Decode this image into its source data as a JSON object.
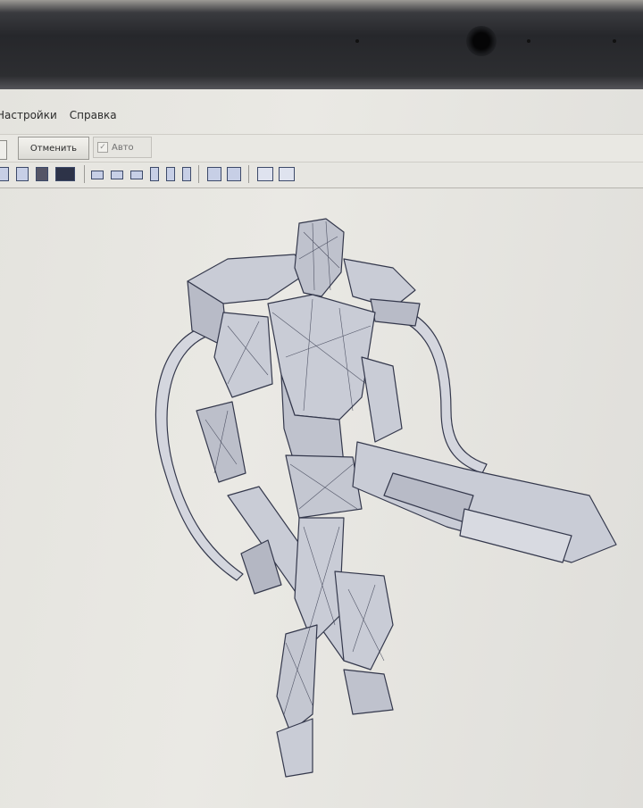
{
  "menubar": {
    "items": [
      "Настройки",
      "Справка"
    ]
  },
  "toolbar": {
    "cancel_label": "Отменить",
    "auto_label": "Авто",
    "auto_checked": true
  },
  "icons": [
    "page-icon",
    "new-page-icon",
    "save-icon",
    "print-icon",
    "align-left-icon",
    "align-center-icon",
    "align-right-icon",
    "align-top-icon",
    "align-middle-icon",
    "align-bottom-icon",
    "group-icon",
    "ungroup-icon",
    "fit-icon",
    "select-all-icon"
  ],
  "colors": {
    "model_fill": "#c9ccd6",
    "model_stroke": "#34384c",
    "background": "#e6e5e0"
  }
}
